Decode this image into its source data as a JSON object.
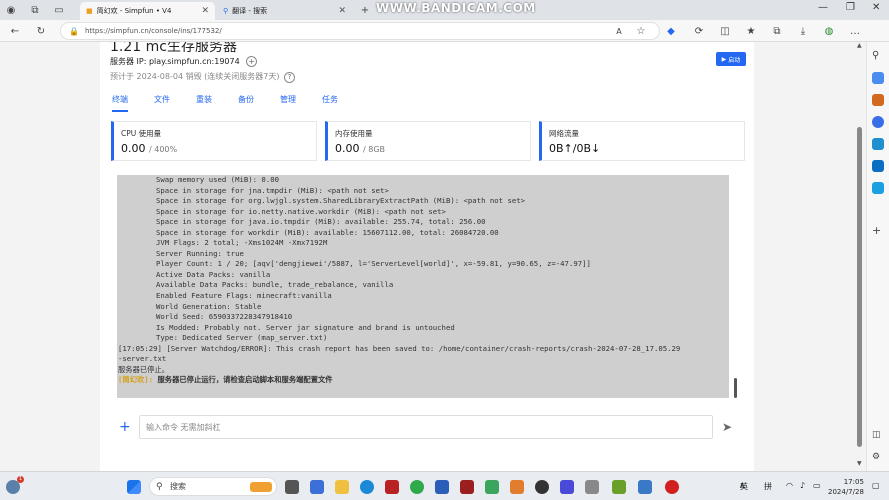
{
  "browser": {
    "tabs": [
      {
        "label": "简幻欢 - Simpfun • V4",
        "active": true
      },
      {
        "label": "翻译 - 搜索",
        "active": false
      }
    ],
    "watermark": "WWW.BANDICAM.COM",
    "url": "https://simpfun.cn/console/ins/177532/"
  },
  "header": {
    "title": "1.21 mc生存服务器",
    "server_ip": "服务器 IP: play.simpfun.cn:19074",
    "expiry": "预计于 2024-08-04 销毁 (连续关闭服务器7天)",
    "start_button": "启动"
  },
  "nav_tabs": [
    "终端",
    "文件",
    "重装",
    "备份",
    "管理",
    "任务"
  ],
  "stats": [
    {
      "label": "CPU 使用量",
      "value": "0.00",
      "unit": "/ 400%"
    },
    {
      "label": "内存使用量",
      "value": "0.00",
      "unit": "/ 8GB"
    },
    {
      "label": "网络流量",
      "value": "0B↑/0B↓",
      "unit": ""
    }
  ],
  "terminal": {
    "lines": [
      "Swap memory used (MiB): 0.00",
      "Space in storage for jna.tmpdir (MiB): <path not set>",
      "Space in storage for org.lwjgl.system.SharedLibraryExtractPath (MiB): <path not set>",
      "Space in storage for io.netty.native.workdir (MiB): <path not set>",
      "Space in storage for java.io.tmpdir (MiB): available: 255.74, total: 256.00",
      "Space in storage for workdir (MiB): available: 15607112.00, total: 26084720.00",
      "JVM Flags: 2 total; -Xms1024M -Xmx7192M",
      "Server Running: true",
      "Player Count: 1 / 20; [aqv['dengjiewei'/5887, l='ServerLevel[world]', x=-59.81, y=90.65, z=-47.97]]",
      "Active Data Packs: vanilla",
      "Available Data Packs: bundle, trade_rebalance, vanilla",
      "Enabled Feature Flags: minecraft:vanilla",
      "World Generation: Stable",
      "World Seed: 6590337228347918410",
      "Is Modded: Probably not. Server jar signature and brand is untouched",
      "Type: Dedicated Server (map_server.txt)"
    ],
    "crash_line_1": "[17:05:29] [Server Watchdog/ERROR]: This crash report has been saved to: /home/container/crash-reports/crash-2024-07-28_17.05.29",
    "crash_line_2": "-server.txt",
    "stopped": "服务器已停止。",
    "notice_prefix": "[简幻欢]:",
    "notice_text": " 服务器已停止运行，请检查启动脚本和服务端配置文件"
  },
  "command": {
    "placeholder": "输入命令 无需加斜杠"
  },
  "taskbar": {
    "search": "搜索",
    "ime_1": "英",
    "ime_2": "拼",
    "time": "17:05",
    "date": "2024/7/28"
  }
}
